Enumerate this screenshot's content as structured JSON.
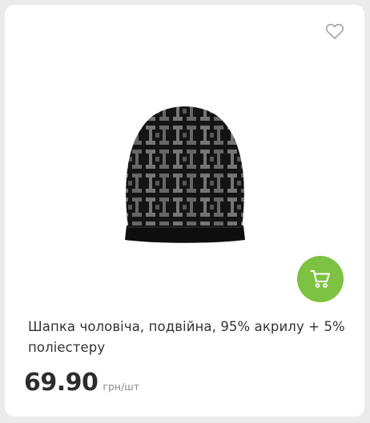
{
  "product": {
    "title": "Шапка чоловіча, подвійна, 95% акрилу + 5% поліестеру",
    "price": "69.90",
    "unit": "грн/шт"
  },
  "icons": {
    "favorite": "heart-outline-icon",
    "cart": "shopping-cart-icon"
  },
  "colors": {
    "accent": "#7dc242",
    "price_text": "#2d2d2d",
    "unit_text": "#8a8a8a",
    "title_text": "#333333",
    "heart_stroke": "#a0a0a0"
  }
}
